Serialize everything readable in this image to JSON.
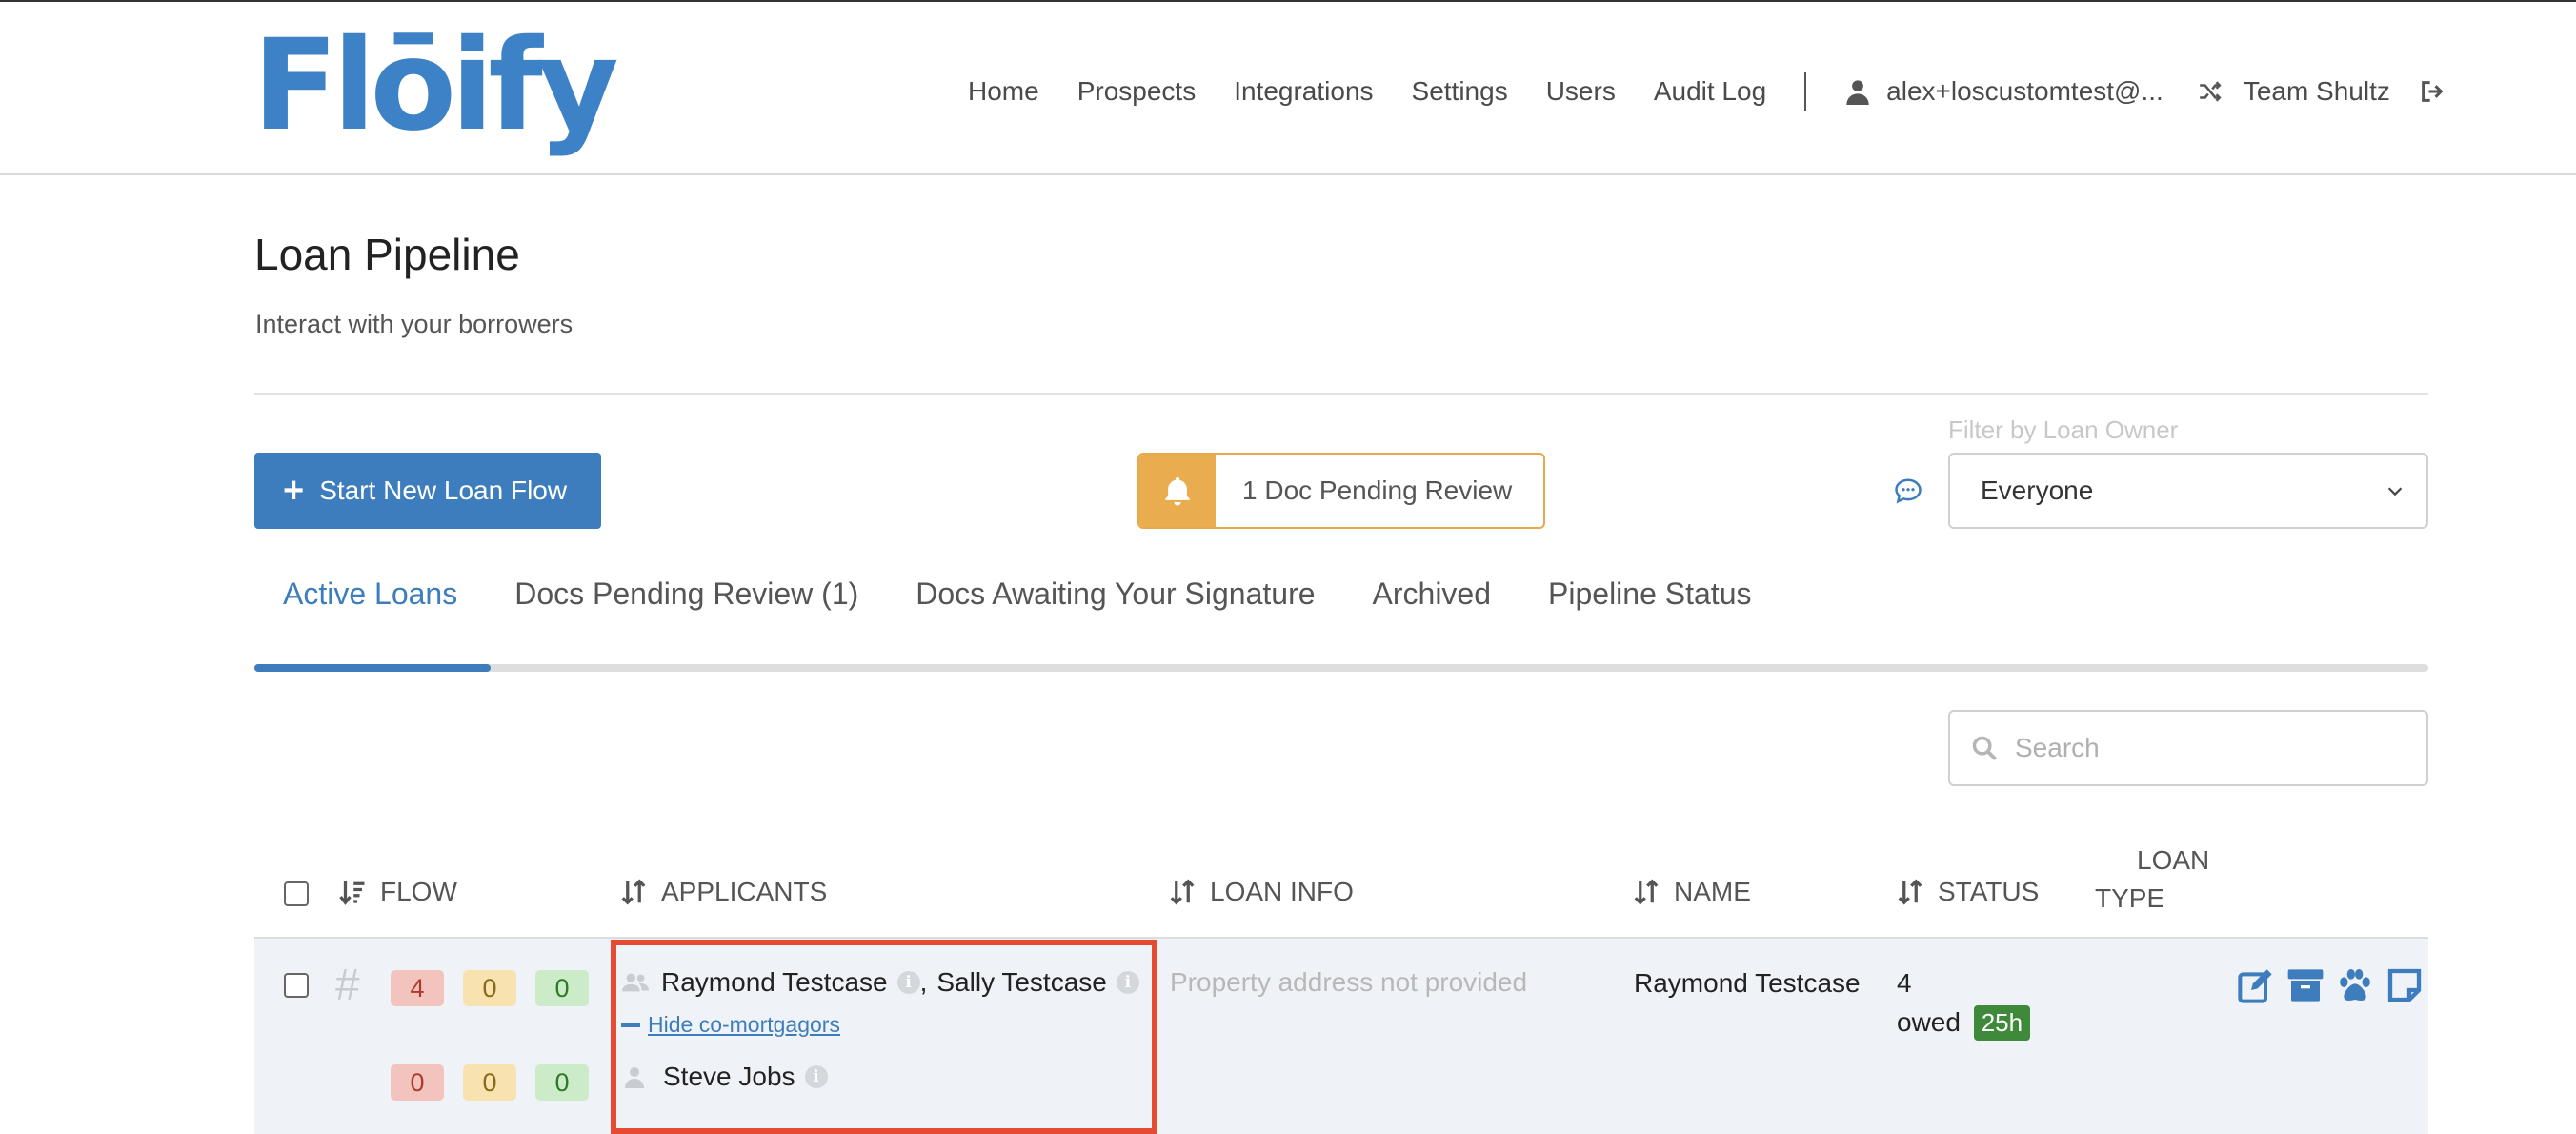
{
  "brand": {
    "logo_text": "Flōify",
    "accent_color": "#3e7dbd"
  },
  "nav": {
    "links": [
      "Home",
      "Prospects",
      "Integrations",
      "Settings",
      "Users",
      "Audit Log"
    ],
    "user_email": "alex+loscustomtest@...",
    "team": "Team Shultz",
    "icons": [
      "user-icon",
      "shuffle-icon",
      "sign-out-icon"
    ]
  },
  "page": {
    "title": "Loan Pipeline",
    "subtitle": "Interact with your borrowers"
  },
  "actions": {
    "start_button": "Start New Loan Flow",
    "doc_pending": "1 Doc Pending Review",
    "filter_label": "Filter by Loan Owner",
    "filter_value": "Everyone"
  },
  "tabs": [
    {
      "label": "Active Loans",
      "active": true
    },
    {
      "label": "Docs Pending Review (1)",
      "active": false
    },
    {
      "label": "Docs Awaiting Your Signature",
      "active": false
    },
    {
      "label": "Archived",
      "active": false
    },
    {
      "label": "Pipeline Status",
      "active": false
    }
  ],
  "search": {
    "placeholder": "Search"
  },
  "table": {
    "columns": {
      "flow": "FLOW",
      "applicants": "APPLICANTS",
      "loan_info": "LOAN INFO",
      "name": "NAME",
      "status": "STATUS",
      "loan_type_line1": "LOAN",
      "loan_type_line2": "TYPE"
    },
    "rows": [
      {
        "flow_counts_top": [
          "4",
          "0",
          "0"
        ],
        "flow_counts_bottom": [
          "0",
          "0",
          "0"
        ],
        "applicant_primary": "Raymond Testcase",
        "applicant_separator": ",",
        "applicant_co": "Sally Testcase",
        "hide_link": "Hide co-mortgagors",
        "applicant_third": "Steve Jobs",
        "loan_info": "Property address not provided",
        "name": "Raymond Testcase",
        "status_count": "4",
        "status_label": "owed",
        "status_time": "25h",
        "action_icons": [
          "edit-icon",
          "archive-icon",
          "paw-icon",
          "note-icon"
        ]
      }
    ]
  }
}
